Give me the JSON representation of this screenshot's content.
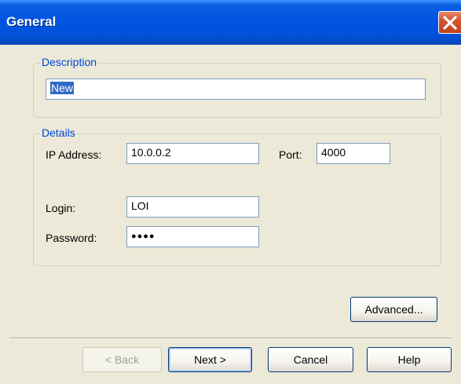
{
  "window": {
    "title": "General"
  },
  "description_group": {
    "label": "Description",
    "value": "New"
  },
  "details_group": {
    "label": "Details",
    "ip_label": "IP Address:",
    "ip_value": "10.0.0.2",
    "port_label": "Port:",
    "port_value": "4000",
    "login_label": "Login:",
    "login_value": "LOI",
    "password_label": "Password:",
    "password_value": "●●●●"
  },
  "buttons": {
    "advanced": "Advanced...",
    "back": "< Back",
    "next": "Next >",
    "cancel": "Cancel",
    "help": "Help"
  },
  "colors": {
    "titlebar": "#0054e3",
    "group_label": "#0046d5",
    "face": "#ece9d8"
  }
}
